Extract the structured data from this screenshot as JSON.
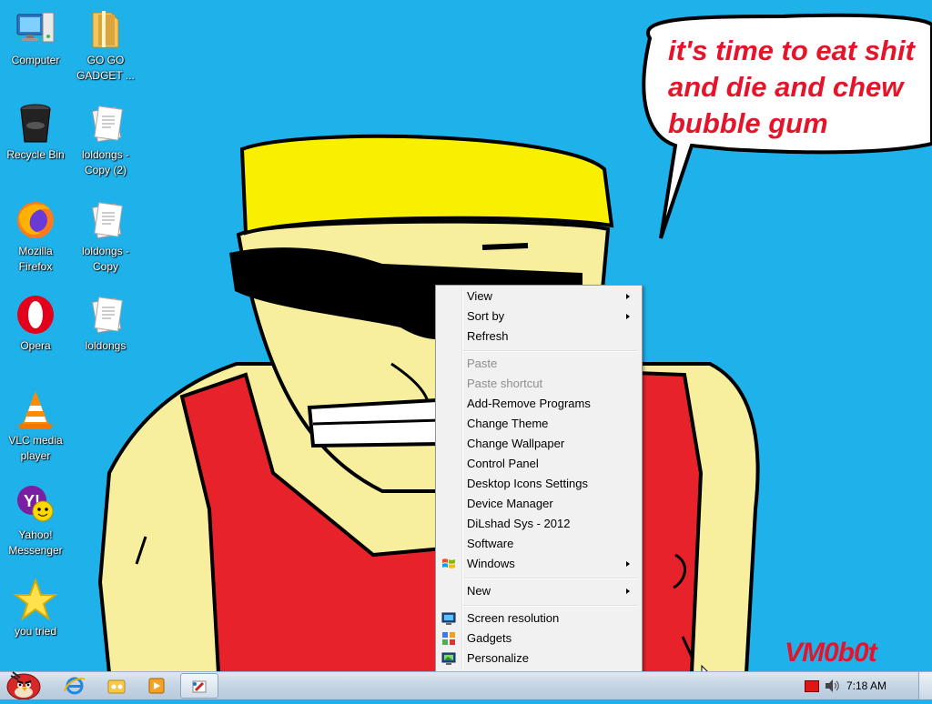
{
  "desktop_icons": [
    {
      "name": "computer-icon",
      "label": "Computer"
    },
    {
      "name": "folder-icon",
      "label": "GO GO GADGET ..."
    },
    {
      "name": "recycle-bin-icon",
      "label": "Recycle Bin"
    },
    {
      "name": "document-icon",
      "label": "loldongs - Copy (2)"
    },
    {
      "name": "firefox-icon",
      "label": "Mozilla Firefox"
    },
    {
      "name": "document-icon",
      "label": "loldongs - Copy"
    },
    {
      "name": "opera-icon",
      "label": "Opera"
    },
    {
      "name": "document-icon",
      "label": "loldongs"
    },
    {
      "name": "vlc-icon",
      "label": "VLC media player"
    },
    {
      "name": "yahoo-messenger-icon",
      "label": "Yahoo! Messenger"
    },
    {
      "name": "star-icon",
      "label": "you tried"
    }
  ],
  "wallpaper": {
    "speech_lines": [
      "it's time to eat shit",
      "and die and chew",
      "bubble gum"
    ],
    "signature": "VM0b0t"
  },
  "context_menu": {
    "items": [
      {
        "label": "View",
        "submenu": true
      },
      {
        "label": "Sort by",
        "submenu": true
      },
      {
        "label": "Refresh"
      },
      {
        "label": "Paste",
        "disabled": true
      },
      {
        "label": "Paste shortcut",
        "disabled": true
      },
      {
        "label": "Add-Remove Programs"
      },
      {
        "label": "Change Theme"
      },
      {
        "label": "Change Wallpaper"
      },
      {
        "label": "Control Panel"
      },
      {
        "label": "Desktop Icons Settings"
      },
      {
        "label": "Device Manager"
      },
      {
        "label": "DiLshad Sys - 2012"
      },
      {
        "label": "Software"
      },
      {
        "label": "Windows",
        "submenu": true,
        "icon": "windows-logo-icon"
      },
      {
        "label": "New",
        "submenu": true
      },
      {
        "label": "Screen resolution",
        "icon": "monitor-icon"
      },
      {
        "label": "Gadgets",
        "icon": "gadgets-icon"
      },
      {
        "label": "Personalize",
        "icon": "personalize-icon"
      }
    ]
  },
  "taskbar": {
    "clock": "7:18 AM",
    "pinned": [
      "start-button-angry-bird-icon",
      "internet-explorer-icon",
      "windows-explorer-icon",
      "media-player-icon",
      "paint-icon"
    ]
  },
  "colors": {
    "desktop_bg": "#1fb1e9",
    "speech_text": "#e5142a"
  }
}
